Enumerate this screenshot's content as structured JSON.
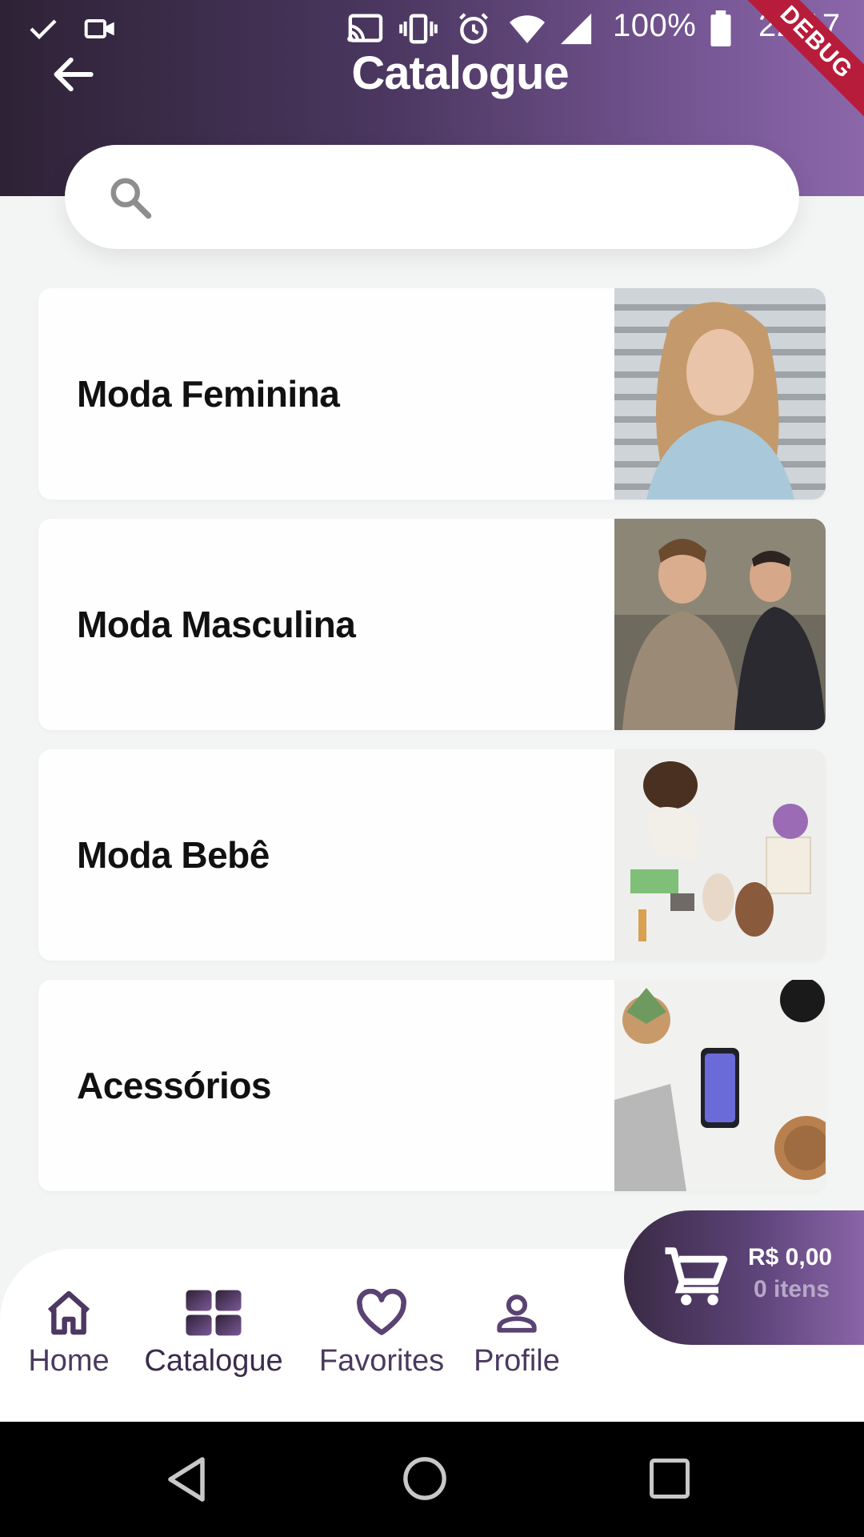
{
  "status_bar": {
    "battery": "100%",
    "time": "22:17",
    "debug_banner": "DEBUG"
  },
  "app_bar": {
    "title": "Catalogue"
  },
  "search": {
    "placeholder": ""
  },
  "categories": [
    {
      "label": "Moda Feminina"
    },
    {
      "label": "Moda Masculina"
    },
    {
      "label": "Moda Bebê"
    },
    {
      "label": "Acessórios"
    }
  ],
  "bottom_nav": {
    "items": [
      {
        "label": "Home",
        "icon": "home-icon"
      },
      {
        "label": "Catalogue",
        "icon": "grid-icon"
      },
      {
        "label": "Favorites",
        "icon": "heart-icon"
      },
      {
        "label": "Profile",
        "icon": "person-icon"
      }
    ]
  },
  "cart": {
    "price": "R$ 0,00",
    "count": "0 itens"
  },
  "colors": {
    "brand_dark": "#2e2236",
    "brand_light": "#8b67aa",
    "background": "#f3f4f4"
  }
}
